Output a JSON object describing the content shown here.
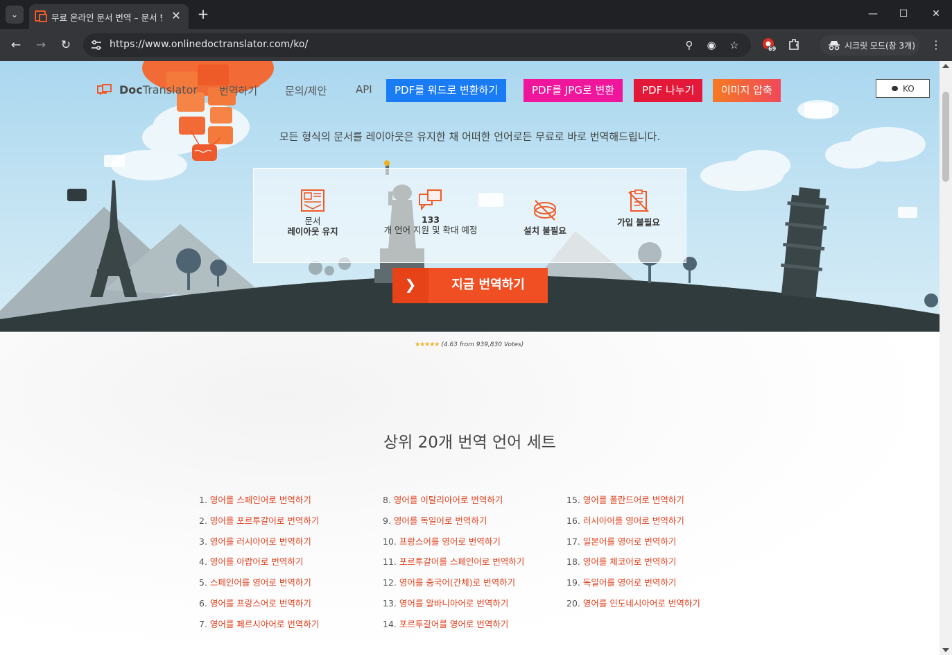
{
  "browser": {
    "tab_title": "무료 온라인 문서 번역 – 문서 번",
    "url": "https://www.onlinedoctranslator.com/ko/",
    "extension_badge": "69",
    "incognito_label": "시크릿 모드(창 3개)"
  },
  "site": {
    "logo_bold": "Doc",
    "logo_rest": "Translator",
    "nav": [
      "번역하기",
      "문의/제안",
      "API"
    ],
    "buttons": [
      {
        "label": "PDF를 워드로 변환하기",
        "color": "#1a7cf5"
      },
      {
        "label": "PDF를 JPG로 변환",
        "color": "#f0169b"
      },
      {
        "label": "PDF 나누기",
        "color": "#e4193a"
      },
      {
        "label": "이미지 압축",
        "color": "#f57a24"
      }
    ],
    "lang_button": "KO",
    "tagline": "모든 형식의 문서를 레이아웃은 유지한 채 어떠한 언어로든 무료로 바로 번역해드립니다.",
    "features": [
      {
        "line1": "문서",
        "line2": "레이아웃 유지",
        "icon": "layout-icon"
      },
      {
        "line1": "133",
        "line2": "개 언어 지원 및 확대 예정",
        "icon": "languages-icon"
      },
      {
        "line1": "",
        "line2": "설치 불필요",
        "icon": "no-install-icon"
      },
      {
        "line1": "가입 불필요",
        "line2": "",
        "icon": "no-signup-icon"
      }
    ],
    "cta_arrow": "❯",
    "cta_label": "지금 번역하기",
    "stars": "★★★★★",
    "rating": "(4.63 from 939,830 Votes)",
    "section_title": "상위 20개 번역 언어 세트",
    "accent_color": "#e0411e",
    "top_translations": [
      {
        "num": "1.",
        "text": "영어를 스페인어로 번역하기"
      },
      {
        "num": "2.",
        "text": "영어를 포르투갈어로 번역하기"
      },
      {
        "num": "3.",
        "text": "영어를 러시아어로 번역하기"
      },
      {
        "num": "4.",
        "text": "영어를 아랍어로 번역하기"
      },
      {
        "num": "5.",
        "text": "스페인어를 영어로 번역하기"
      },
      {
        "num": "6.",
        "text": "영어를 프랑스어로 번역하기"
      },
      {
        "num": "7.",
        "text": "영어를 페르시아어로 번역하기"
      },
      {
        "num": "8.",
        "text": "영어를 이탈리아어로 번역하기"
      },
      {
        "num": "9.",
        "text": "영어를 독일어로 번역하기"
      },
      {
        "num": "10.",
        "text": "프랑스어를 영어로 번역하기"
      },
      {
        "num": "11.",
        "text": "포르투갈어를 스페인어로 번역하기"
      },
      {
        "num": "12.",
        "text": "영어를 중국어(간체)로 번역하기"
      },
      {
        "num": "13.",
        "text": "영어를 알바니아어로 번역하기"
      },
      {
        "num": "14.",
        "text": "포르투갈어를 영어로 번역하기"
      },
      {
        "num": "15.",
        "text": "영어를 폴란드어로 번역하기"
      },
      {
        "num": "16.",
        "text": "러시아어를 영어로 번역하기"
      },
      {
        "num": "17.",
        "text": "일본어를 영어로 번역하기"
      },
      {
        "num": "18.",
        "text": "영어를 체코어로 번역하기"
      },
      {
        "num": "19.",
        "text": "독일어를 영어로 번역하기"
      },
      {
        "num": "20.",
        "text": "영어를 인도네시아어로 번역하기"
      }
    ]
  }
}
